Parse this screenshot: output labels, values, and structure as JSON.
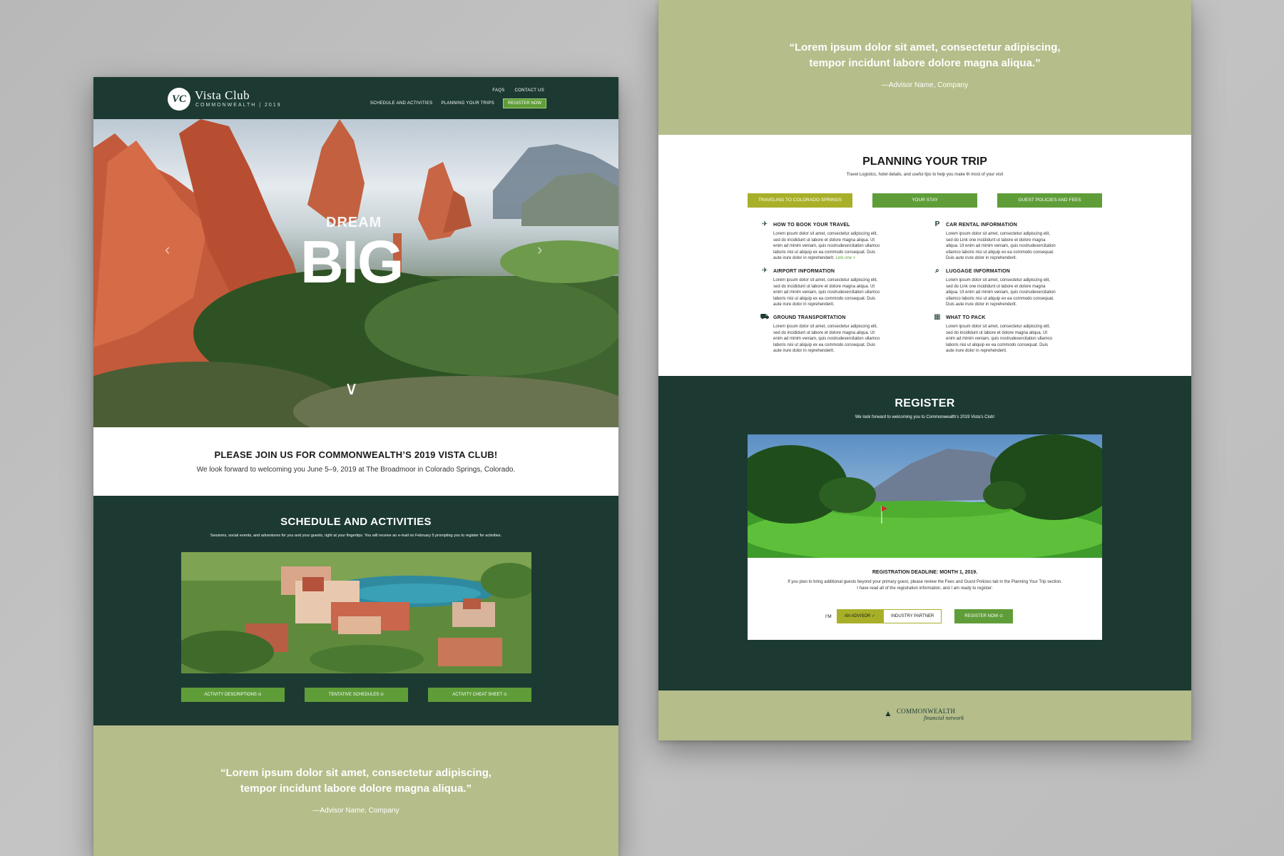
{
  "left_page": {
    "header": {
      "logo_mark": "VC",
      "logo_name": "Vista Club",
      "logo_sub": "COMMONWEALTH | 2019",
      "nav_top": [
        "FAQS",
        "CONTACT US"
      ],
      "nav_main": [
        "SCHEDULE AND ACTIVITIES",
        "PLANNING YOUR TRIPS"
      ],
      "register_button": "REGISTER NOW"
    },
    "hero": {
      "line1": "DREAM",
      "line2": "BIG",
      "prev_icon": "‹",
      "next_icon": "›",
      "down_icon": "∨"
    },
    "intro": {
      "title": "PLEASE JOIN US FOR COMMONWEALTH’S 2019 VISTA CLUB!",
      "text": "We look forward to welcoming you June 5–9, 2019 at The Broadmoor in Colorado Springs, Colorado."
    },
    "schedule": {
      "title": "SCHEDULE AND ACTIVITIES",
      "subtitle": "Sessions, social events, and adventures for you and your guests, right at your fingertips. You will receive an e-mail on February 5 prompting you to register for activities.",
      "buttons": [
        "ACTIVITY DESCRIPTIONS ⊙",
        "TENTATIVE SCHEDULES ⊙",
        "ACTIVITY CHEAT SHEET ⊙"
      ]
    },
    "quote": {
      "text_line1": "“Lorem ipsum dolor sit amet, consectetur adipiscing,",
      "text_line2": "tempor incidunt labore dolore magna aliqua.”",
      "attribution": "—Advisor Name, Company"
    }
  },
  "right_page": {
    "quote": {
      "text_line1": "“Lorem ipsum dolor sit amet, consectetur adipiscing,",
      "text_line2": "tempor incidunt labore dolore magna aliqua.”",
      "attribution": "—Advisor Name, Company"
    },
    "planning": {
      "title": "PLANNING YOUR TRIP",
      "subtitle": "Travel Logistics, hotel details, and useful tips to help you make th most of your visit",
      "tabs": [
        "TRAVELING TO COLORADO SPRINGS",
        "YOUR STAY",
        "GUEST POLICIES AND FEES"
      ],
      "items": [
        {
          "icon": "airplane-takeoff-icon",
          "glyph": "✈",
          "title": "HOW TO BOOK YOUR TRAVEL",
          "body": "Lorem ipsum dolor sit amet, consectetur adipiscing elit, sed do incididunt ut labore et dolore magna aliqua. Ut enim ad minim veniam, quis nostrudexercitation ullamco laboris nisi ut aliquip ex ea commodo consequat. Duis aute irure dolor in reprehenderit.",
          "link": "Link one >"
        },
        {
          "icon": "parking-icon",
          "glyph": "P",
          "title": "CAR RENTAL INFORMATION",
          "body": "Lorem ipsum dolor sit amet, consectetur adipiscing elit, sed do Link one incididunt ut labore et dolore magna aliqua. Ut enim ad minim veniam, quis nostrudexercitation ullamco laboris nisi ut aliquip ex ea commodo consequat. Duis aute irure dolor in reprehenderit.",
          "link": ""
        },
        {
          "icon": "airplane-icon",
          "glyph": "✈",
          "title": "AIRPORT INFORMATION",
          "body": "Lorem ipsum dolor sit amet, consectetur adipiscing elit, sed do incididunt ut labore et dolore magna aliqua. Ut enim ad minim veniam, quis nostrudexercitation ullamco laboris nisi ut aliquip ex ea commodo consequat. Duis aute irure dolor in reprehenderit.",
          "link": ""
        },
        {
          "icon": "luggage-tag-icon",
          "glyph": "⌕",
          "title": "LUGGAGE INFORMATION",
          "body": "Lorem ipsum dolor sit amet, consectetur adipiscing elit, sed do Link one incididunt ut labore et dolore magna aliqua. Ut enim ad minim veniam, quis nostrudexercitation ullamco laboris nisi ut aliquip ex ea commodo consequat. Duis aute irure dolor in reprehenderit.",
          "link": ""
        },
        {
          "icon": "car-icon",
          "glyph": "⛟",
          "title": "GROUND TRANSPORTATION",
          "body": "Lorem ipsum dolor sit amet, consectetur adipiscing elit, sed do incididunt ut labore et dolore magna aliqua. Ut enim ad minim veniam, quis nostrudexercitation ullamco laboris nisi ut aliquip ex ea commodo consequat. Duis aute irure dolor in reprehenderit.",
          "link": ""
        },
        {
          "icon": "suitcase-icon",
          "glyph": "▦",
          "title": "WHAT TO PACK",
          "body": "Lorem ipsum dolor sit amet, consectetur adipiscing elit, sed do incididunt ut labore et dolore magna aliqua. Ut enim ad minim veniam, quis nostrudexercitation ullamco laboris nisi ut aliquip ex ea commodo consequat. Duis aute irure dolor in reprehenderit.",
          "link": ""
        }
      ]
    },
    "register": {
      "title": "REGISTER",
      "subtitle": "We look forward to welcoming you to Commonwealth’s 2019 Vista’s Club!",
      "deadline": "REGISTRATION DEADLINE: MONTH 1, 2019.",
      "text_line1": "If you plan to bring additional guests beyond your primary guest, please review the Fees and Guest Policies tab in the Planning Your Trip section.",
      "text_line2": "I have read all of the registration information, and I am ready to register:",
      "im_label": "I’M",
      "option_selected": "AN ADVISOR ✓",
      "option_unselected": "INDUSTRY PARTNER",
      "button": "REGISTER NOW ⊙"
    },
    "footer": {
      "logo_line1": "COMMONWEALTH",
      "logo_line2": "financial network",
      "logo_mark": "▲"
    }
  },
  "colors": {
    "dark_green": "#1c3a32",
    "button_green": "#5f9d39",
    "olive_tab": "#a8b02a",
    "sage": "#b5bd8a"
  }
}
